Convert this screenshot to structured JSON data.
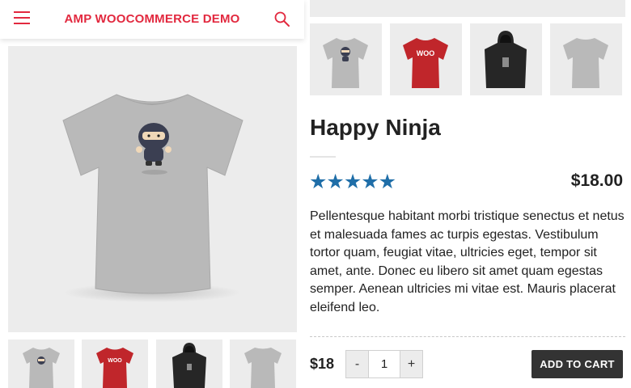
{
  "header": {
    "site_title": "AMP WOOCOMMERCE DEMO",
    "menu_icon": "hamburger-menu-icon",
    "search_icon": "search-icon",
    "accent_color": "#e2293f"
  },
  "gallery": {
    "main_image": "grey-tshirt-ninja-image",
    "thumbnails": [
      {
        "name": "grey-tshirt-ninja-thumbnail"
      },
      {
        "name": "red-tshirt-woo-thumbnail"
      },
      {
        "name": "black-hoodie-ninja-thumbnail"
      },
      {
        "name": "grey-tshirt-back-thumbnail"
      }
    ]
  },
  "product": {
    "title": "Happy Ninja",
    "rating": "★★★★★",
    "rating_value": 5,
    "rating_max": 5,
    "rating_color": "#1f6ea8",
    "price": "$18.00",
    "description": "Pellentesque habitant morbi tristique senectus et netus et malesuada fames ac turpis egestas. Vestibulum tortor quam, feugiat vitae, ultricies eget, tempor sit amet, ante. Donec eu libero sit amet quam egestas semper. Aenean ultricies mi vitae est. Mauris placerat eleifend leo."
  },
  "cart": {
    "price": "$18",
    "minus_label": "-",
    "quantity": "1",
    "plus_label": "+",
    "add_to_cart_label": "ADD TO CART"
  }
}
